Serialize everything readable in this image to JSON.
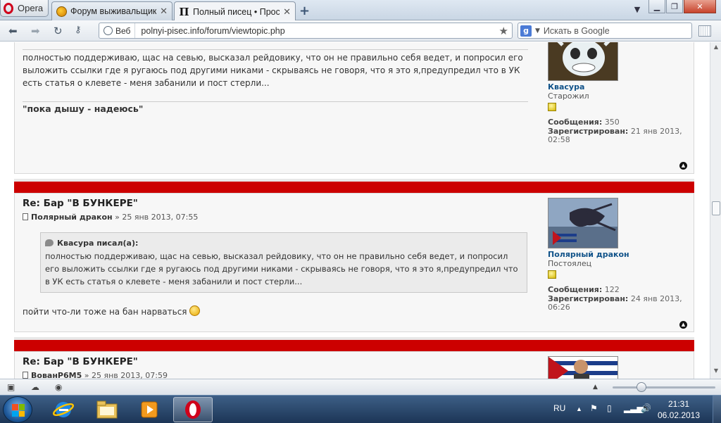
{
  "browser": {
    "menu_label": "Opera",
    "tabs": [
      {
        "title": "Форум выживальщик..."
      },
      {
        "title": "Полный писец • Прос..."
      }
    ],
    "address": {
      "mode_label": "Веб",
      "url": "polnyi-pisec.info/forum/viewtopic.php"
    },
    "search": {
      "placeholder": "Искать в Google"
    }
  },
  "posts": [
    {
      "partial": true,
      "body": "полностью поддерживаю, щас на севью, высказал рейдовику, что он не правильно себя ведет, и попросил его выложить ссылки где я ругаюсь под другими никами - скрываясь не говоря, что я это я,предупредил что в УК есть статья о клевете - меня забанили и пост стерли...",
      "signature": "\"пока дышу - надеюсь\"",
      "author": {
        "name": "Квасура",
        "rank": "Старожил",
        "posts_label": "Сообщения:",
        "posts_value": "350",
        "registered_label": "Зарегистрирован:",
        "registered_value": "21 янв 2013, 02:58"
      }
    },
    {
      "title": "Re: Бар \"В БУНКЕРЕ\"",
      "author_name": "Полярный дракон",
      "date": "» 25 янв 2013, 07:55",
      "quote": {
        "cite": "Квасура писал(а):",
        "text": "полностью поддерживаю, щас на севью, высказал рейдовику, что он не правильно себя ведет, и попросил его выложить ссылки где я ругаюсь под другими никами - скрываясь не говоря, что я это я,предупредил что в УК есть статья о клевете - меня забанили и пост стерли..."
      },
      "body": "пойти что-ли тоже на бан нарваться",
      "author": {
        "name": "Полярный дракон",
        "rank": "Постоялец",
        "posts_label": "Сообщения:",
        "posts_value": "122",
        "registered_label": "Зарегистрирован:",
        "registered_value": "24 янв 2013, 06:26"
      }
    },
    {
      "title": "Re: Бар \"В БУНКЕРЕ\"",
      "author_name": "ВованP6M5",
      "date": "» 25 янв 2013, 07:59"
    }
  ],
  "taskbar": {
    "language": "RU",
    "time": "21:31",
    "date": "06.02.2013"
  },
  "colors": {
    "post_bar": "#cc0000",
    "username": "#105289",
    "taskbar": "#1c3556"
  }
}
